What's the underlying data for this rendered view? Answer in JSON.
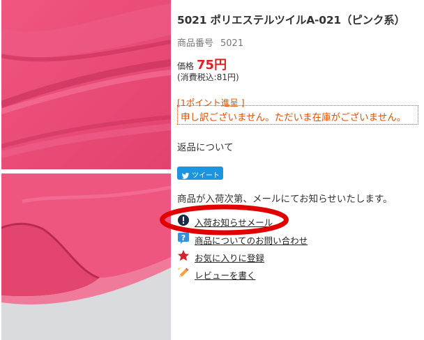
{
  "product": {
    "title": "5021 ポリエステルツイルA-021（ピンク系）",
    "code_label": "商品番号",
    "code_value": "5021",
    "price_label": "価格",
    "price_value": "75円",
    "tax_included": "(消費税込:81円)",
    "points": "[1ポイント進呈 ]",
    "stock_message": "申し訳ございません。ただいま在庫がございません。",
    "returns_link": "返品について",
    "tweet_label": "ツイート",
    "restock_notice": "商品が入荷次第、メールにてお知らせいたします。"
  },
  "links": [
    {
      "label": "入荷お知らせメール",
      "icon": "exclamation-circle-icon"
    },
    {
      "label": "商品についてのお問い合わせ",
      "icon": "question-icon"
    },
    {
      "label": "お気に入りに登録",
      "icon": "star-icon"
    },
    {
      "label": "レビューを書く",
      "icon": "pencil-icon"
    }
  ],
  "colors": {
    "price": "#e02020",
    "warning": "#e05000",
    "tweet": "#1b95e0",
    "highlight_ellipse": "#e00000",
    "fabric": "#e94a76"
  }
}
